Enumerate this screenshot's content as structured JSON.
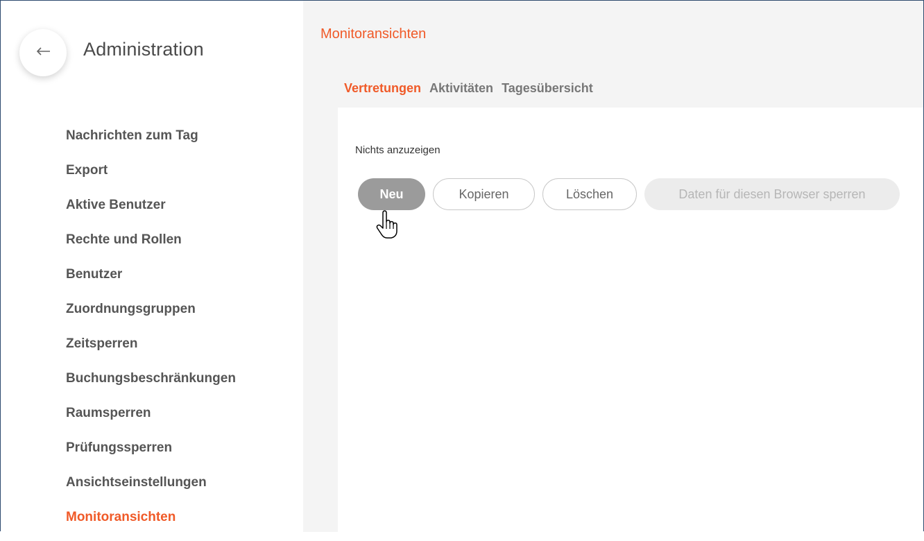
{
  "sidebar": {
    "title": "Administration",
    "back_icon": "arrow-left-icon",
    "items": [
      {
        "label": "Nachrichten zum Tag",
        "active": false
      },
      {
        "label": "Export",
        "active": false
      },
      {
        "label": "Aktive Benutzer",
        "active": false
      },
      {
        "label": "Rechte und Rollen",
        "active": false
      },
      {
        "label": "Benutzer",
        "active": false
      },
      {
        "label": "Zuordnungsgruppen",
        "active": false
      },
      {
        "label": "Zeitsperren",
        "active": false
      },
      {
        "label": "Buchungsbeschränkungen",
        "active": false
      },
      {
        "label": "Raumsperren",
        "active": false
      },
      {
        "label": "Prüfungssperren",
        "active": false
      },
      {
        "label": "Ansichtseinstellungen",
        "active": false
      },
      {
        "label": "Monitoransichten",
        "active": true
      }
    ]
  },
  "main": {
    "title": "Monitoransichten",
    "tabs": [
      {
        "label": "Vertretungen",
        "active": true
      },
      {
        "label": "Aktivitäten",
        "active": false
      },
      {
        "label": "Tagesübersicht",
        "active": false
      }
    ],
    "empty_text": "Nichts anzuzeigen",
    "buttons": {
      "new": "Neu",
      "copy": "Kopieren",
      "delete": "Löschen",
      "lock": "Daten für diesen Browser sperren"
    }
  },
  "colors": {
    "accent": "#f05a28",
    "primary_button": "#9b9b9b",
    "main_background": "#f4f4f4"
  }
}
